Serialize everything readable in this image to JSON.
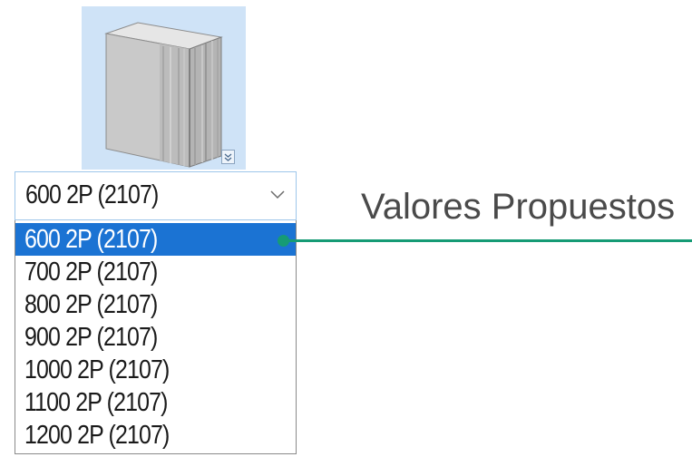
{
  "thumbnail": {
    "icon": "wardrobe-2-door-icon",
    "background": "#cfe3f7",
    "expand_icon": "expand-chevron-icon"
  },
  "combo": {
    "selected_value": "600 2P (2107)",
    "arrow_icon": "chevron-down-icon"
  },
  "dropdown": {
    "options": [
      "600 2P (2107)",
      "700 2P (2107)",
      "800 2P (2107)",
      "900 2P (2107)",
      "1000 2P (2107)",
      "1100 2P (2107)",
      "1200 2P (2107)"
    ],
    "selected_index": 0,
    "highlight_color": "#1b73d3"
  },
  "annotation": {
    "label": "Valores Propuestos",
    "color": "#169b75"
  }
}
